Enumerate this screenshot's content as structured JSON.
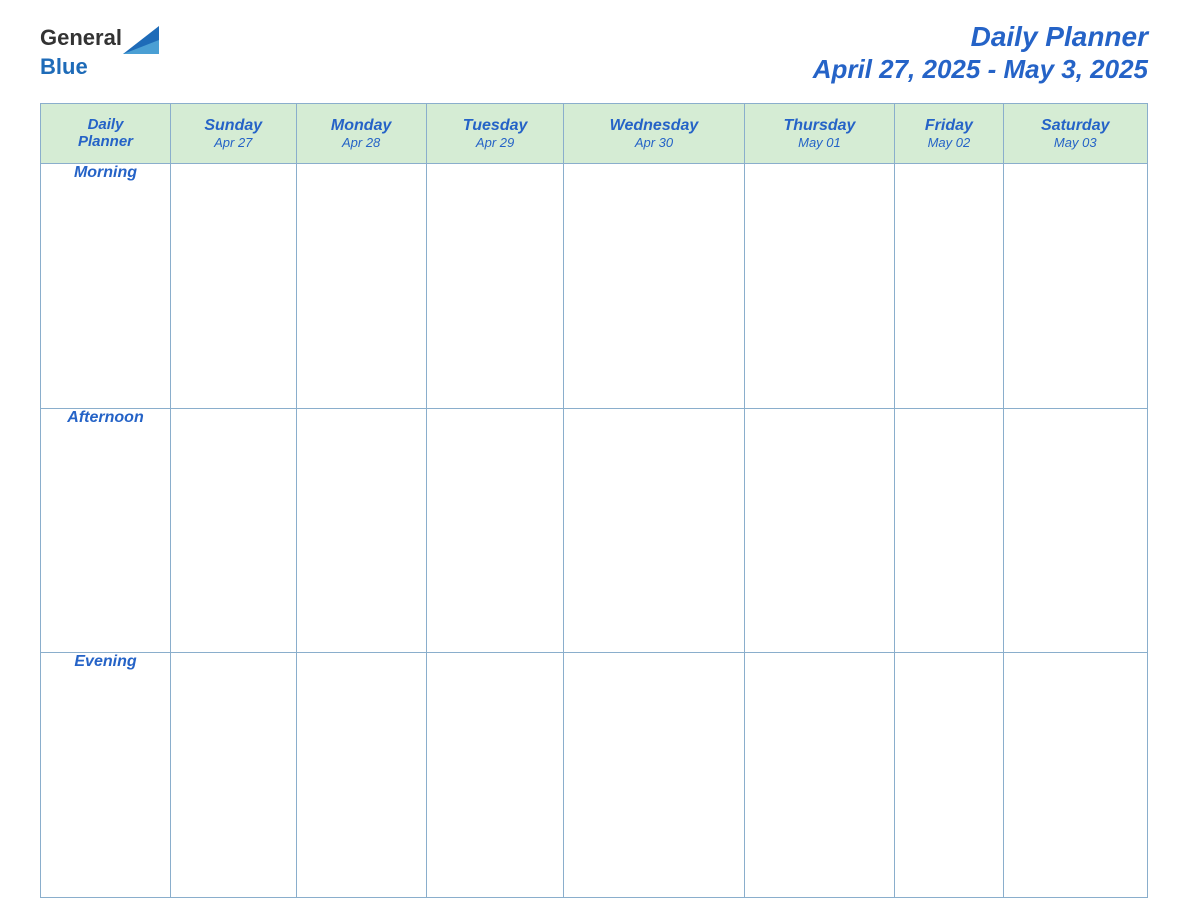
{
  "header": {
    "logo_text_general": "General",
    "logo_text_blue": "Blue",
    "title": "Daily Planner",
    "date_range": "April 27, 2025 - May 3, 2025"
  },
  "table": {
    "corner_label_line1": "Daily",
    "corner_label_line2": "Planner",
    "columns": [
      {
        "day": "Sunday",
        "date": "Apr 27"
      },
      {
        "day": "Monday",
        "date": "Apr 28"
      },
      {
        "day": "Tuesday",
        "date": "Apr 29"
      },
      {
        "day": "Wednesday",
        "date": "Apr 30"
      },
      {
        "day": "Thursday",
        "date": "May 01"
      },
      {
        "day": "Friday",
        "date": "May 02"
      },
      {
        "day": "Saturday",
        "date": "May 03"
      }
    ],
    "rows": [
      {
        "label": "Morning"
      },
      {
        "label": "Afternoon"
      },
      {
        "label": "Evening"
      }
    ]
  }
}
